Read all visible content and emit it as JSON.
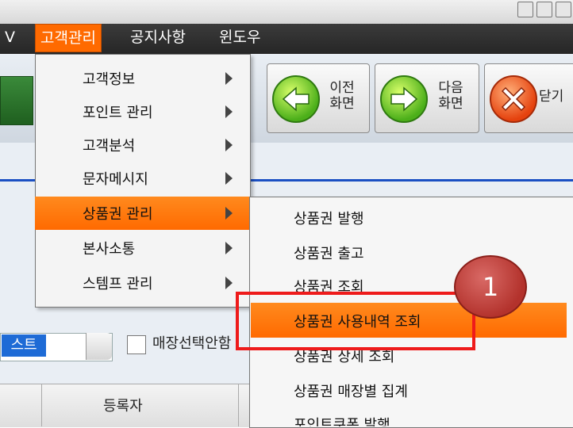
{
  "menubar": {
    "items": [
      {
        "label": "V"
      },
      {
        "label": "고객관리"
      },
      {
        "label": "공지사항"
      },
      {
        "label": "윈도우"
      }
    ]
  },
  "toolbar": {
    "prev": {
      "line1": "이전",
      "line2": "화면"
    },
    "next": {
      "line1": "다음",
      "line2": "화면"
    },
    "close": {
      "label": "닫기"
    }
  },
  "main_menu": {
    "items": [
      {
        "label": "고객정보"
      },
      {
        "label": "포인트 관리"
      },
      {
        "label": "고객분석"
      },
      {
        "label": "문자메시지"
      },
      {
        "label": "상품권 관리"
      },
      {
        "label": "본사소통"
      },
      {
        "label": "스템프 관리"
      }
    ]
  },
  "sub_menu": {
    "items": [
      {
        "label": "상품권 발행"
      },
      {
        "label": "상품권 출고"
      },
      {
        "label": "상품권 조회"
      },
      {
        "label": "상품권 사용내역 조회"
      },
      {
        "label": "상품권 상세 조회"
      },
      {
        "label": "상품권 매장별 집계"
      },
      {
        "label": "포인트쿠폰 발행"
      }
    ]
  },
  "filters": {
    "store_select_value": "스트",
    "store_check_label": "매장선택안함"
  },
  "grid": {
    "columns": [
      {
        "label": "등록자"
      }
    ]
  },
  "annotation": {
    "step": "1"
  },
  "colors": {
    "accent": "#ff6a00",
    "menubar": "#2f2f2f",
    "highlight": "#ee1b1b",
    "selection": "#1e6bd6"
  }
}
